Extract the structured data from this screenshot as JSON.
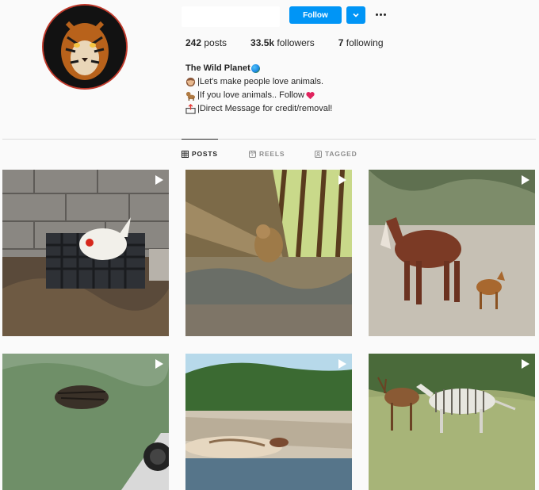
{
  "profile": {
    "follow_label": "Follow",
    "stats": {
      "posts_count": "242",
      "posts_label": "posts",
      "followers_count": "33.5k",
      "followers_label": "followers",
      "following_count": "7",
      "following_label": "following"
    },
    "bio": {
      "name": "The Wild Planet",
      "lines": [
        "|Let's make people love animals.",
        "|If you love animals.. Follow",
        "|Direct Message for credit/removal!"
      ]
    }
  },
  "tabs": [
    {
      "label": "POSTS",
      "icon": "grid-icon",
      "active": true
    },
    {
      "label": "REELS",
      "icon": "reels-icon",
      "active": false
    },
    {
      "label": "TAGGED",
      "icon": "tagged-icon",
      "active": false
    }
  ],
  "colors": {
    "accent": "#0095f6",
    "background": "#fafafa",
    "divider": "#dbdbdb",
    "muted_text": "#8e8e8e"
  }
}
